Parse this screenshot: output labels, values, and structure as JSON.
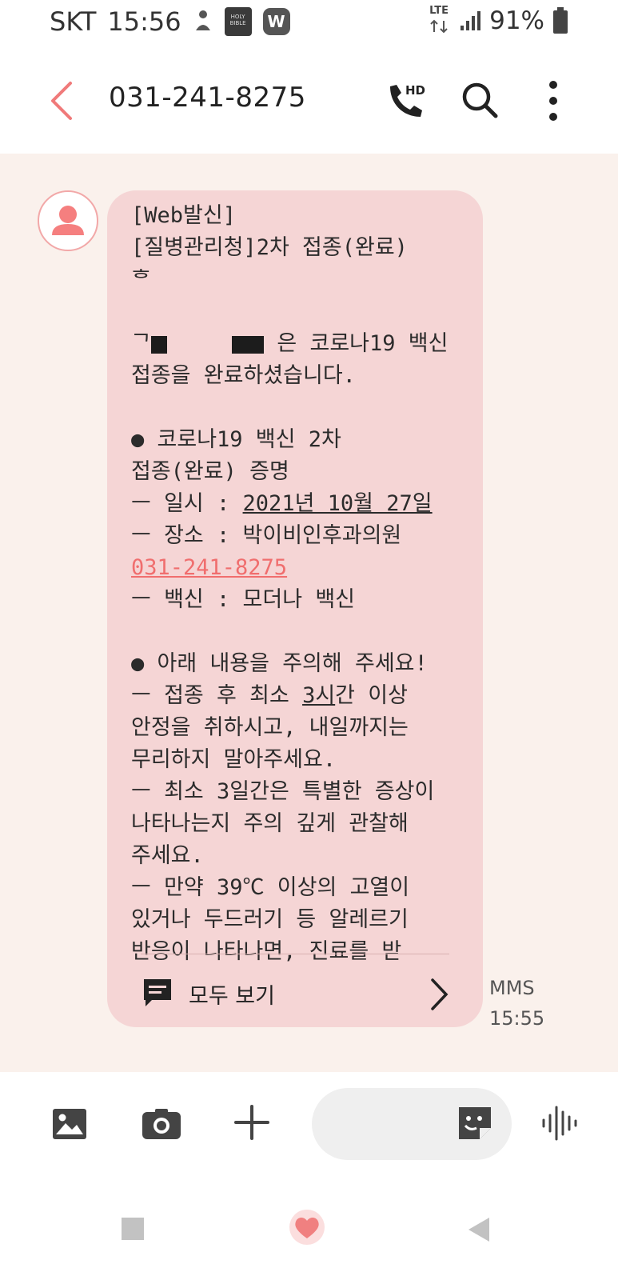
{
  "status_bar": {
    "carrier": "SKT",
    "time": "15:56",
    "bible_icon_text": "HOLY BIBLE",
    "app_badge": "W",
    "network": "LTE",
    "battery": "91%"
  },
  "header": {
    "title": "031-241-8275"
  },
  "message": {
    "lines": {
      "l1": "[Web발신]",
      "l2": "[질병관리청]2차 접종(완료)",
      "l3": "ᄒ",
      "l4_pre": "ᄀ",
      "l4_post": " 은 코로나19 백신",
      "l5": "접종을 완료하셨습니다.",
      "l6": "● 코로나19 백신 2차",
      "l7": "접종(완료) 증명",
      "l8_pre": "ㅡ 일시 : ",
      "l8_date": "2021년 10월 27일",
      "l9": "ㅡ 장소 : 박이비인후과의원",
      "l10_phone": "031-241-8275",
      "l11": "ㅡ 백신 : 모더나 백신",
      "l12": "● 아래 내용을 주의해 주세요!",
      "l13_pre": "ㅡ 접종 후 최소 ",
      "l13_u": "3시",
      "l13_post": "간 이상",
      "l14": "안정을 취하시고, 내일까지는",
      "l15": "무리하지 말아주세요.",
      "l16": "ㅡ 최소 3일간은 특별한 증상이",
      "l17": "나타나는지 주의 깊게 관찰해",
      "l18": "주세요.",
      "l19": "ㅡ 만약 39℃ 이상의 고열이",
      "l20": "있거나 두드러기 등 알레르기",
      "l21": "반응이 나타나면, 진료를 받"
    },
    "view_all_label": "모두 보기",
    "type": "MMS",
    "time": "15:55"
  },
  "colors": {
    "bubble": "#f5d5d5",
    "accent": "#f06e6e",
    "background": "#faf1ec"
  }
}
